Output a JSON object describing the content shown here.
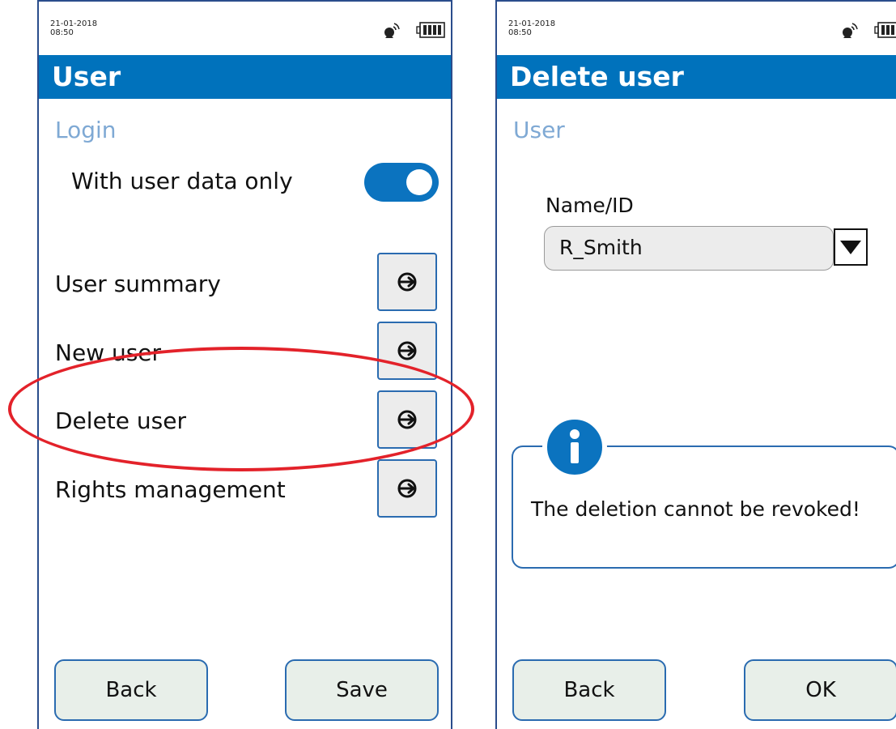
{
  "left": {
    "status": {
      "date": "21-01-2018",
      "time": "08:50"
    },
    "title": "User",
    "section": "Login",
    "toggle": {
      "label": "With user data only",
      "state": "on"
    },
    "menu": [
      {
        "label": "User summary"
      },
      {
        "label": "New user"
      },
      {
        "label": "Delete user"
      },
      {
        "label": "Rights management"
      }
    ],
    "buttons": {
      "back": "Back",
      "save": "Save"
    }
  },
  "right": {
    "status": {
      "date": "21-01-2018",
      "time": "08:50"
    },
    "title": "Delete user",
    "section": "User",
    "field": {
      "label": "Name/ID",
      "value": "R_Smith"
    },
    "info": {
      "message": "The deletion cannot be revoked!"
    },
    "buttons": {
      "back": "Back",
      "ok": "OK"
    }
  },
  "colors": {
    "accent": "#0072bc",
    "highlight": "#e3222a",
    "section_label": "#7fa9d4"
  },
  "icons": [
    "satellite-icon",
    "battery-icon",
    "arrow-right-icon",
    "dropdown-arrow-icon",
    "info-icon"
  ]
}
